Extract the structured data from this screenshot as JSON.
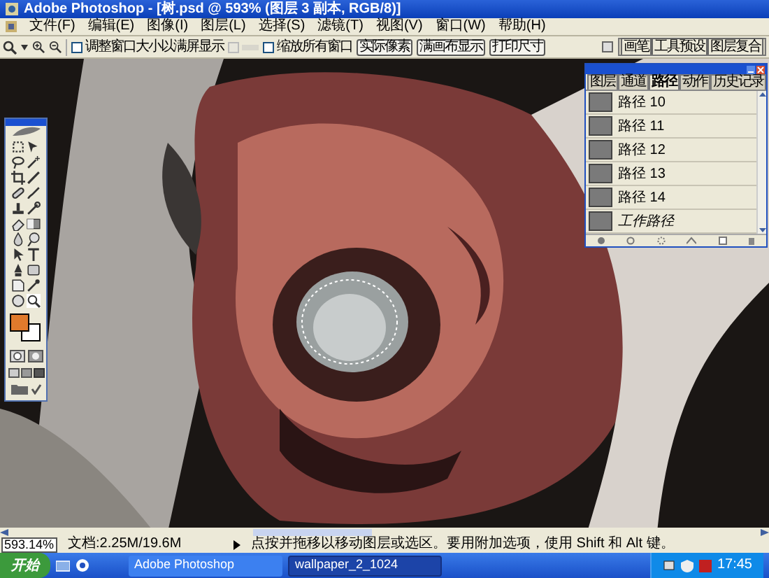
{
  "window": {
    "title": "Adobe Photoshop - [树.psd @ 593% (图层 3 副本, RGB/8)]"
  },
  "menu": [
    "文件(F)",
    "编辑(E)",
    "图像(I)",
    "图层(L)",
    "选择(S)",
    "滤镜(T)",
    "视图(V)",
    "窗口(W)",
    "帮助(H)"
  ],
  "options": {
    "checkboxes": [
      {
        "label": "调整窗口大小以满屏显示",
        "checked": false,
        "disabled": false
      },
      {
        "checked": false,
        "disabled": true
      },
      {
        "label": "缩放所有窗口",
        "checked": false,
        "disabled": false
      }
    ],
    "buttons": [
      "实际像素",
      "满画布显示",
      "打印尺寸"
    ]
  },
  "dock_tabs": [
    "画笔",
    "工具预设",
    "图层复合"
  ],
  "swatches": [
    {
      "color": "#e07a2c"
    },
    {
      "color": "#ffffff"
    }
  ],
  "paths_palette": {
    "tabs": [
      {
        "label": "图层",
        "selected": false
      },
      {
        "label": "通道",
        "selected": false
      },
      {
        "label": "路径",
        "selected": true
      },
      {
        "label": "动作",
        "selected": false
      },
      {
        "label": "历史记录",
        "selected": false
      }
    ],
    "rows": [
      {
        "label": "路径 10",
        "italic": false
      },
      {
        "label": "路径 11",
        "italic": false
      },
      {
        "label": "路径 12",
        "italic": false
      },
      {
        "label": "路径 13",
        "italic": false
      },
      {
        "label": "路径 14",
        "italic": false
      },
      {
        "label": "工作路径",
        "italic": true
      }
    ]
  },
  "status_bar": {
    "zoom": "593.14%",
    "doc": "文档:2.25M/19.6M",
    "hint": "点按并拖移以移动图层或选区。要用附加选项，使用 Shift 和 Alt 键。"
  },
  "taskbar": {
    "start": "开始",
    "tasks": [
      {
        "label": "Adobe Photoshop",
        "selected": false
      },
      {
        "label": "wallpaper_2_1024",
        "selected": true
      }
    ],
    "clock": "17:45"
  }
}
